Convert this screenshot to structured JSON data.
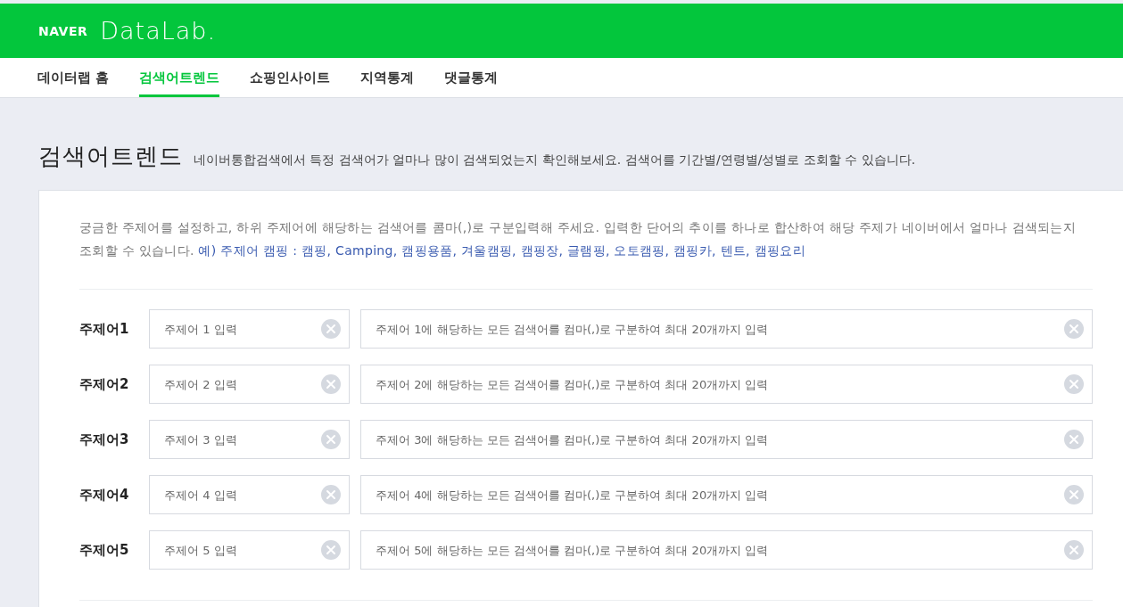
{
  "header": {
    "brand": "NAVER",
    "product": "DataLab."
  },
  "nav": [
    {
      "label": "데이터랩 홈",
      "selected": false
    },
    {
      "label": "검색어트렌드",
      "selected": true
    },
    {
      "label": "쇼핑인사이트",
      "selected": false
    },
    {
      "label": "지역통계",
      "selected": false
    },
    {
      "label": "댓글통계",
      "selected": false
    }
  ],
  "page": {
    "title": "검색어트렌드",
    "subtitle": "네이버통합검색에서 특정 검색어가 얼마나 많이 검색되었는지 확인해보세요. 검색어를 기간별/연령별/성별로 조회할 수 있습니다."
  },
  "guide": {
    "text": "궁금한 주제어를 설정하고, 하위 주제어에 해당하는 검색어를 콤마(,)로 구분입력해 주세요. 입력한 단어의 추이를 하나로 합산하여 해당 주제가 네이버에서 얼마나 검색되는지 조회할 수 있습니다.",
    "example": "예) 주제어 캠핑 : 캠핑, Camping, 캠핑용품, 겨울캠핑, 캠핑장, 글램핑, 오토캠핑, 캠핑카, 텐트, 캠핑요리"
  },
  "topics": [
    {
      "label": "주제어1",
      "topic_placeholder": "주제어 1 입력",
      "keywords_placeholder": "주제어 1에 해당하는 모든 검색어를 컴마(,)로 구분하여 최대 20개까지 입력"
    },
    {
      "label": "주제어2",
      "topic_placeholder": "주제어 2 입력",
      "keywords_placeholder": "주제어 2에 해당하는 모든 검색어를 컴마(,)로 구분하여 최대 20개까지 입력"
    },
    {
      "label": "주제어3",
      "topic_placeholder": "주제어 3 입력",
      "keywords_placeholder": "주제어 3에 해당하는 모든 검색어를 컴마(,)로 구분하여 최대 20개까지 입력"
    },
    {
      "label": "주제어4",
      "topic_placeholder": "주제어 4 입력",
      "keywords_placeholder": "주제어 4에 해당하는 모든 검색어를 컴마(,)로 구분하여 최대 20개까지 입력"
    },
    {
      "label": "주제어5",
      "topic_placeholder": "주제어 5 입력",
      "keywords_placeholder": "주제어 5에 해당하는 모든 검색어를 컴마(,)로 구분하여 최대 20개까지 입력"
    }
  ]
}
